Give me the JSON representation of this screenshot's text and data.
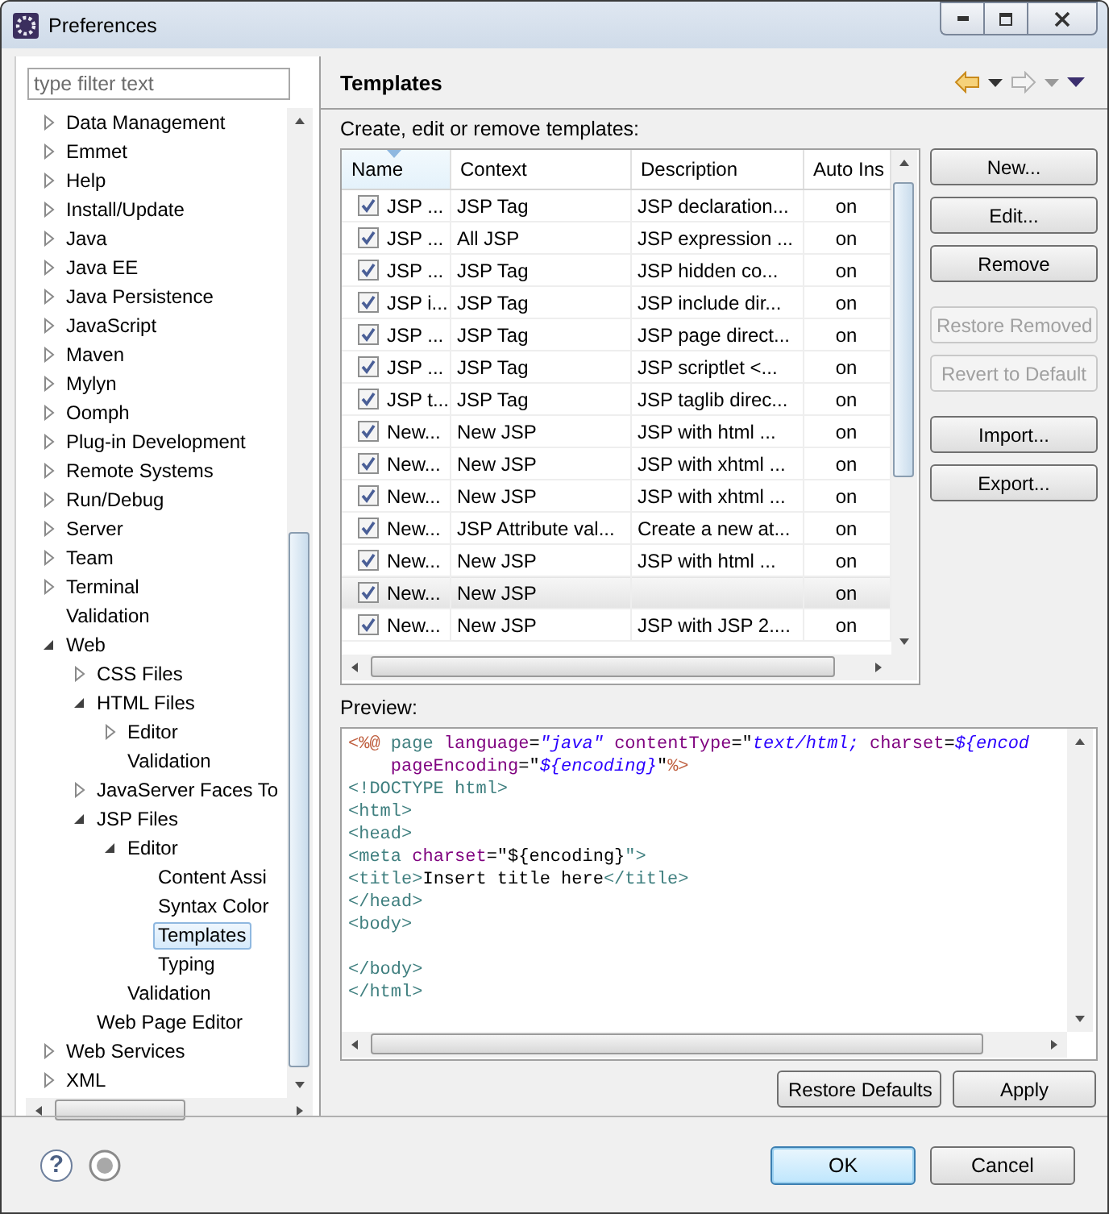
{
  "window": {
    "title": "Preferences"
  },
  "filter": {
    "placeholder": "type filter text"
  },
  "tree": [
    {
      "label": "Data Management",
      "expanded": false,
      "selected": false
    },
    {
      "label": "Emmet",
      "expanded": false,
      "selected": false
    },
    {
      "label": "Help",
      "expanded": false,
      "selected": false
    },
    {
      "label": "Install/Update",
      "expanded": false,
      "selected": false
    },
    {
      "label": "Java",
      "expanded": false,
      "selected": false
    },
    {
      "label": "Java EE",
      "expanded": false,
      "selected": false
    },
    {
      "label": "Java Persistence",
      "expanded": false,
      "selected": false
    },
    {
      "label": "JavaScript",
      "expanded": false,
      "selected": false
    },
    {
      "label": "Maven",
      "expanded": false,
      "selected": false
    },
    {
      "label": "Mylyn",
      "expanded": false,
      "selected": false
    },
    {
      "label": "Oomph",
      "expanded": false,
      "selected": false
    },
    {
      "label": "Plug-in Development",
      "expanded": false,
      "selected": false
    },
    {
      "label": "Remote Systems",
      "expanded": false,
      "selected": false
    },
    {
      "label": "Run/Debug",
      "expanded": false,
      "selected": false
    },
    {
      "label": "Server",
      "expanded": false,
      "selected": false
    },
    {
      "label": "Team",
      "expanded": false,
      "selected": false
    },
    {
      "label": "Terminal",
      "expanded": false,
      "selected": false
    },
    {
      "label": "Validation",
      "selected": false
    },
    {
      "label": "Web",
      "expanded": true,
      "selected": false,
      "children": [
        {
          "label": "CSS Files",
          "expanded": false,
          "selected": false
        },
        {
          "label": "HTML Files",
          "expanded": true,
          "selected": false,
          "children": [
            {
              "label": "Editor",
              "expanded": false,
              "selected": false
            },
            {
              "label": "Validation",
              "selected": false
            }
          ]
        },
        {
          "label": "JavaServer Faces To",
          "expanded": false,
          "selected": false
        },
        {
          "label": "JSP Files",
          "expanded": true,
          "selected": false,
          "children": [
            {
              "label": "Editor",
              "expanded": true,
              "selected": false,
              "children": [
                {
                  "label": "Content Assi",
                  "selected": false
                },
                {
                  "label": "Syntax Color",
                  "selected": false
                },
                {
                  "label": "Templates",
                  "selected": true
                },
                {
                  "label": "Typing",
                  "selected": false
                }
              ]
            },
            {
              "label": "Validation",
              "selected": false
            }
          ]
        },
        {
          "label": "Web Page Editor",
          "selected": false
        }
      ]
    },
    {
      "label": "Web Services",
      "expanded": false,
      "selected": false
    },
    {
      "label": "XML",
      "expanded": false,
      "selected": false
    }
  ],
  "page": {
    "title": "Templates",
    "description": "Create, edit or remove templates:"
  },
  "table": {
    "columns": [
      {
        "label": "Name",
        "sorted": true
      },
      {
        "label": "Context",
        "sorted": false
      },
      {
        "label": "Description",
        "sorted": false
      },
      {
        "label": "Auto Ins",
        "sorted": false
      }
    ],
    "rows": [
      {
        "name": "JSP ...",
        "context": "JSP Tag",
        "description": "JSP declaration...",
        "auto_insert": "on",
        "checked": true,
        "selected": false
      },
      {
        "name": "JSP ...",
        "context": "All JSP",
        "description": "JSP expression ...",
        "auto_insert": "on",
        "checked": true,
        "selected": false
      },
      {
        "name": "JSP ...",
        "context": "JSP Tag",
        "description": "JSP hidden co...",
        "auto_insert": "on",
        "checked": true,
        "selected": false
      },
      {
        "name": "JSP i...",
        "context": "JSP Tag",
        "description": "JSP include dir...",
        "auto_insert": "on",
        "checked": true,
        "selected": false
      },
      {
        "name": "JSP ...",
        "context": "JSP Tag",
        "description": "JSP page direct...",
        "auto_insert": "on",
        "checked": true,
        "selected": false
      },
      {
        "name": "JSP ...",
        "context": "JSP Tag",
        "description": "JSP scriptlet <...",
        "auto_insert": "on",
        "checked": true,
        "selected": false
      },
      {
        "name": "JSP t...",
        "context": "JSP Tag",
        "description": "JSP taglib direc...",
        "auto_insert": "on",
        "checked": true,
        "selected": false
      },
      {
        "name": "New...",
        "context": "New JSP",
        "description": "JSP with html ...",
        "auto_insert": "on",
        "checked": true,
        "selected": false
      },
      {
        "name": "New...",
        "context": "New JSP",
        "description": "JSP with xhtml ...",
        "auto_insert": "on",
        "checked": true,
        "selected": false
      },
      {
        "name": "New...",
        "context": "New JSP",
        "description": "JSP with xhtml ...",
        "auto_insert": "on",
        "checked": true,
        "selected": false
      },
      {
        "name": "New...",
        "context": "JSP Attribute val...",
        "description": "Create a new at...",
        "auto_insert": "on",
        "checked": true,
        "selected": false
      },
      {
        "name": "New...",
        "context": "New JSP",
        "description": "JSP with html ...",
        "auto_insert": "on",
        "checked": true,
        "selected": false
      },
      {
        "name": "New...",
        "context": "New JSP",
        "auto_insert": "on",
        "checked": true,
        "selected": true
      },
      {
        "name": "New...",
        "context": "New JSP",
        "description": "JSP with JSP 2....",
        "auto_insert": "on",
        "checked": true,
        "selected": false
      }
    ]
  },
  "side_buttons": [
    [
      {
        "label": "New...",
        "disabled": false
      },
      {
        "label": "Edit...",
        "disabled": false
      },
      {
        "label": "Remove",
        "disabled": false
      }
    ],
    [
      {
        "label": "Restore Removed",
        "disabled": true
      },
      {
        "label": "Revert to Default",
        "disabled": true
      }
    ],
    [
      {
        "label": "Import...",
        "disabled": false
      },
      {
        "label": "Export...",
        "disabled": false
      }
    ]
  ],
  "preview": {
    "label": "Preview:",
    "lines": [
      {
        "kind": "code",
        "tokens": [
          {
            "kind": "delim",
            "text": "<%@"
          },
          {
            "kind": "tag",
            "text": " page"
          },
          {
            "kind": "attr",
            "text": " language"
          },
          {
            "kind": "plain",
            "text": "="
          },
          {
            "kind": "value",
            "text": "\"java\""
          },
          {
            "kind": "attr",
            "text": " contentType"
          },
          {
            "kind": "plain",
            "text": "=\""
          },
          {
            "kind": "value",
            "text": "text/html;"
          },
          {
            "kind": "attr",
            "text": " charset"
          },
          {
            "kind": "plain",
            "text": "="
          },
          {
            "kind": "value",
            "text": "${encod"
          }
        ]
      },
      {
        "kind": "code",
        "tokens": [
          {
            "kind": "attr",
            "text": "    pageEncoding"
          },
          {
            "kind": "plain",
            "text": "=\""
          },
          {
            "kind": "value",
            "text": "${encoding}"
          },
          {
            "kind": "plain",
            "text": "\""
          },
          {
            "kind": "delim",
            "text": "%>"
          }
        ]
      },
      {
        "kind": "code",
        "tokens": [
          {
            "kind": "tag",
            "text": "<!DOCTYPE html>"
          }
        ]
      },
      {
        "kind": "code",
        "tokens": [
          {
            "kind": "tag",
            "text": "<html>"
          }
        ]
      },
      {
        "kind": "code",
        "tokens": [
          {
            "kind": "tag",
            "text": "<head>"
          }
        ]
      },
      {
        "kind": "code",
        "tokens": [
          {
            "kind": "tag",
            "text": "<meta"
          },
          {
            "kind": "attr",
            "text": " charset"
          },
          {
            "kind": "plain",
            "text": "=\"${encoding}"
          },
          {
            "kind": "tag",
            "text": "\">"
          }
        ]
      },
      {
        "kind": "code",
        "tokens": [
          {
            "kind": "tag",
            "text": "<title>"
          },
          {
            "kind": "plain",
            "text": "Insert title here"
          },
          {
            "kind": "tag",
            "text": "</title>"
          }
        ]
      },
      {
        "kind": "code",
        "tokens": [
          {
            "kind": "tag",
            "text": "</head>"
          }
        ]
      },
      {
        "kind": "code",
        "tokens": [
          {
            "kind": "tag",
            "text": "<body>"
          }
        ]
      },
      {
        "kind": "blank"
      },
      {
        "kind": "code",
        "tokens": [
          {
            "kind": "tag",
            "text": "</body>"
          }
        ]
      },
      {
        "kind": "code",
        "tokens": [
          {
            "kind": "tag",
            "text": "</html>"
          }
        ]
      }
    ]
  },
  "page_buttons": [
    {
      "label": "Restore Defaults"
    },
    {
      "label": "Apply"
    }
  ],
  "footer": {
    "help": "?",
    "buttons": [
      {
        "label": "OK",
        "default": true
      },
      {
        "label": "Cancel",
        "default": false
      }
    ]
  }
}
